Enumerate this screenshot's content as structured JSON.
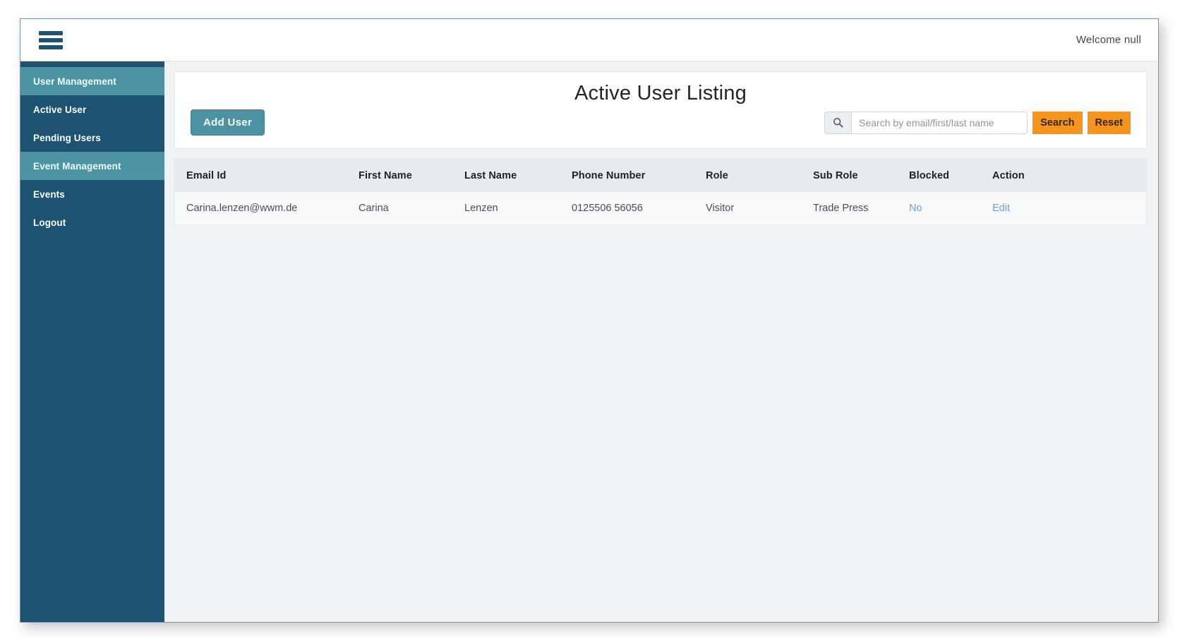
{
  "topbar": {
    "menu_icon": "hamburger-icon",
    "welcome_text": "Welcome null"
  },
  "sidebar": {
    "items": [
      {
        "label": "User Management",
        "type": "section"
      },
      {
        "label": "Active User",
        "type": "link"
      },
      {
        "label": "Pending Users",
        "type": "link"
      },
      {
        "label": "Event Management",
        "type": "section"
      },
      {
        "label": "Events",
        "type": "link"
      },
      {
        "label": "Logout",
        "type": "link"
      }
    ]
  },
  "main": {
    "title": "Active User Listing",
    "add_user_label": "Add User",
    "search": {
      "icon": "search-icon",
      "placeholder": "Search by email/first/last name",
      "value": "",
      "search_label": "Search",
      "reset_label": "Reset"
    },
    "table": {
      "columns": [
        "Email Id",
        "First Name",
        "Last Name",
        "Phone Number",
        "Role",
        "Sub Role",
        "Blocked",
        "Action"
      ],
      "rows": [
        {
          "email": "Carina.lenzen@wwm.de",
          "first_name": "Carina",
          "last_name": "Lenzen",
          "phone": "0125506 56056",
          "role": "Visitor",
          "sub_role": "Trade Press",
          "blocked": "No",
          "action": "Edit"
        }
      ]
    }
  },
  "colors": {
    "sidebar_bg": "#1d5270",
    "sidebar_section": "#4c93a4",
    "accent_teal": "#4c92a3",
    "accent_orange": "#f7941d",
    "content_bg": "#eff3f6",
    "link_blue": "#6d9fe8"
  }
}
